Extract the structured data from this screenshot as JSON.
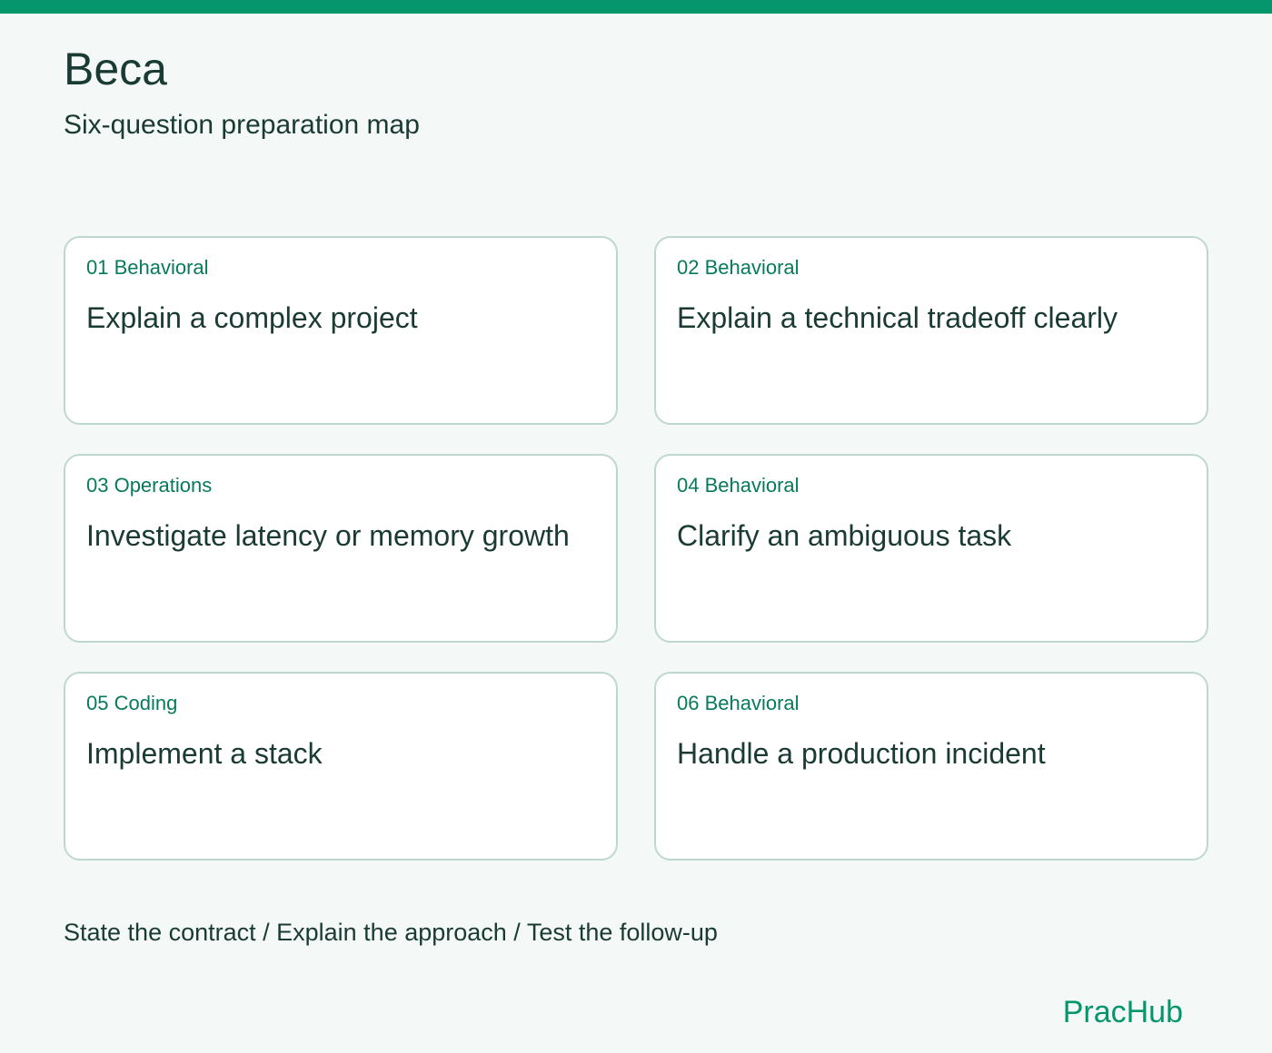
{
  "header": {
    "title": "Beca",
    "subtitle": "Six-question preparation map"
  },
  "cards": [
    {
      "tag": "01 Behavioral",
      "title": "Explain a complex project"
    },
    {
      "tag": "02 Behavioral",
      "title": "Explain a technical tradeoff clearly"
    },
    {
      "tag": "03 Operations",
      "title": "Investigate latency or memory growth"
    },
    {
      "tag": "04 Behavioral",
      "title": "Clarify an ambiguous task"
    },
    {
      "tag": "05 Coding",
      "title": "Implement a stack"
    },
    {
      "tag": "06 Behavioral",
      "title": "Handle a production incident"
    }
  ],
  "footer": {
    "note": "State the contract / Explain the approach / Test the follow-up",
    "brand": "PracHub"
  },
  "colors": {
    "accent": "#05966b",
    "tag_text": "#077a5b",
    "text": "#1a3a34",
    "card_border": "#bcd8cf",
    "background": "#f4f8f6"
  }
}
